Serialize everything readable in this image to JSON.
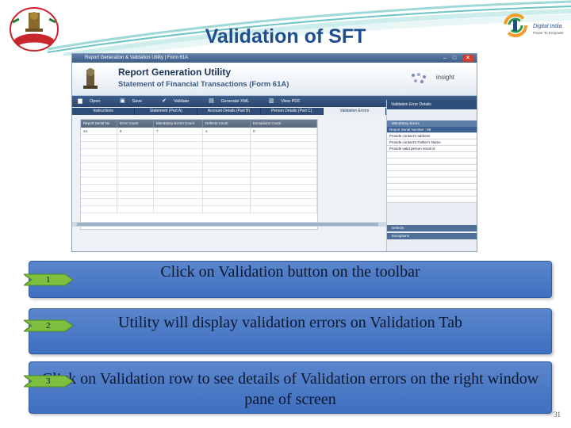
{
  "slide": {
    "title": "Validation of SFT",
    "page_number": "31"
  },
  "brand": {
    "digital_india": "Digital India",
    "digital_india_sub": "Power To Empower",
    "accent": "#1f4e8c"
  },
  "app": {
    "window_title": "Report Generation & Validation Utility | Form 61A",
    "banner_title": "Report Generation Utility",
    "banner_subtitle": "Statement of Financial Transactions (Form 61A)",
    "insight_label": "insight",
    "toolbar": [
      {
        "label": "Open",
        "icon": "folder-icon"
      },
      {
        "label": "Save",
        "icon": "save-icon"
      },
      {
        "label": "Validate",
        "icon": "check-icon"
      },
      {
        "label": "Generate XML",
        "icon": "xml-icon"
      },
      {
        "label": "View PDF",
        "icon": "pdf-icon"
      }
    ],
    "tabs": [
      "Instructions",
      "Statement (Part A)",
      "Account Details (Part B)",
      "Person Details (Part C)",
      "Validation Errors"
    ],
    "active_tab": 4,
    "grid": {
      "columns": [
        "Report Serial No",
        "Error Count",
        "Mandatory Errors Count",
        "Defects Count",
        "Exceptions Count"
      ],
      "rows": [
        [
          "24",
          "6",
          "7",
          "1",
          "0"
        ]
      ]
    },
    "right_panel": {
      "header": "Validation Error Details",
      "section": "Mandatory Errors",
      "rows": [
        "Report Serial Number : 66",
        "Provide contact's address",
        "Provide contact's Father's Name",
        "Provide valid person email id"
      ],
      "defects_label": "Defects",
      "exceptions_label": "Exceptions"
    }
  },
  "steps": [
    {
      "number": "1",
      "text": "Click on Validation button on the toolbar"
    },
    {
      "number": "2",
      "text": "Utility will display validation errors on Validation Tab"
    },
    {
      "number": "3",
      "text": "Click on Validation row to see details of Validation errors on the right window pane of screen"
    }
  ]
}
